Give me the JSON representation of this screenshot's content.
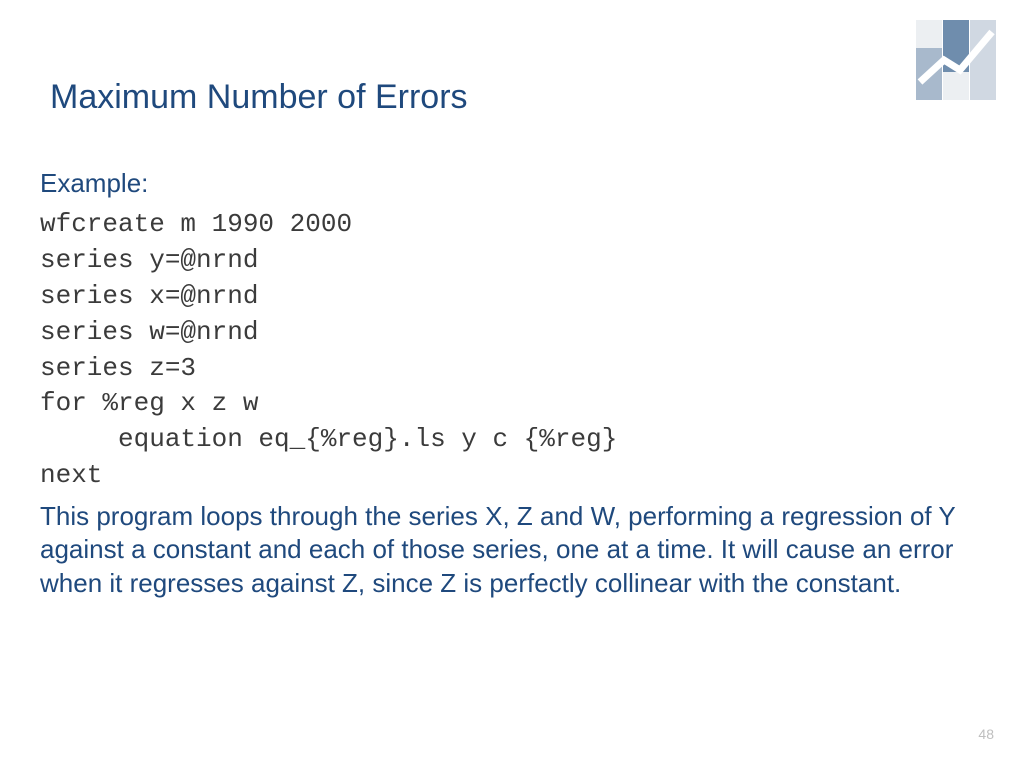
{
  "title": "Maximum Number of Errors",
  "example_label": "Example:",
  "code": {
    "l1": "wfcreate m 1990 2000",
    "l2": "series y=@nrnd",
    "l3": "series x=@nrnd",
    "l4": "series w=@nrnd",
    "l5": "series z=3",
    "l6": "for %reg x z w",
    "l7": "     equation eq_{%reg}.ls y c {%reg}",
    "l8": "next"
  },
  "body_text": "This program loops through the series X, Z and W, performing a regression of Y against a constant and each of those series, one at a time. It will cause an error when it regresses against Z, since Z is perfectly collinear with the constant.",
  "page_number": "48"
}
